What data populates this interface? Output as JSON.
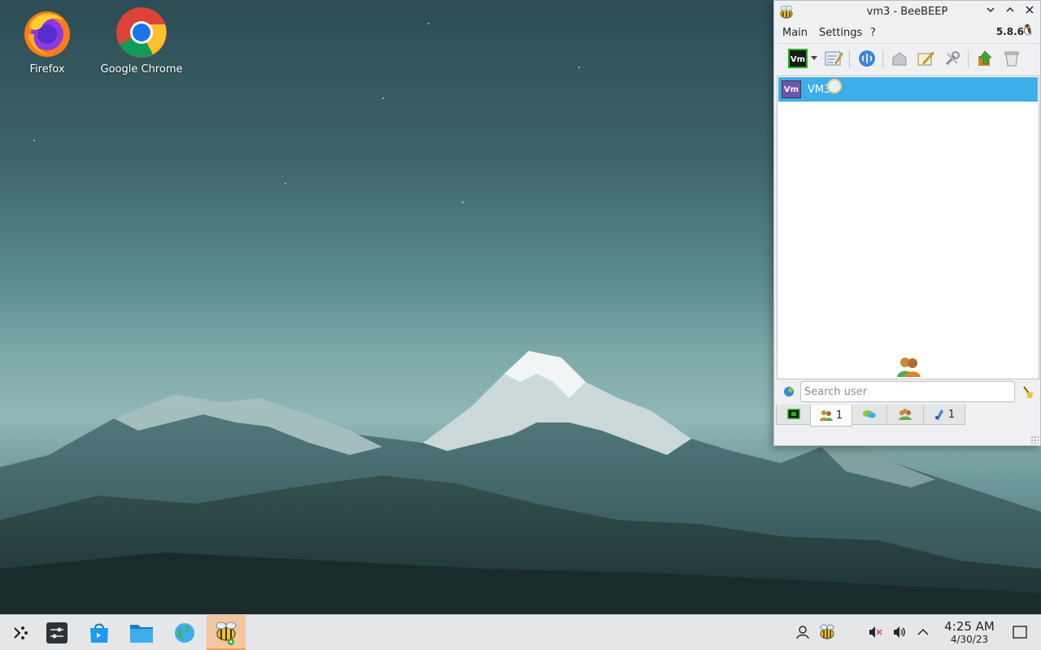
{
  "desktop": {
    "icons": [
      {
        "label": "Firefox",
        "icon": "firefox-icon"
      },
      {
        "label": "Google Chrome",
        "icon": "chrome-icon"
      }
    ]
  },
  "window": {
    "title": "vm3 - BeeBEEP",
    "menu": {
      "main": "Main",
      "settings": "Settings",
      "help": "?"
    },
    "version": "5.8.6",
    "toolbar": [
      "user-status-icon",
      "dropdown-arrow-icon",
      "profile-edit-icon",
      "network-icon",
      "home-icon",
      "pencil-note-icon",
      "tools-icon",
      "update-icon",
      "trash-icon"
    ],
    "users": [
      {
        "avatar": "Vm",
        "name": "VM3"
      }
    ],
    "search": {
      "placeholder": "Search user",
      "value": ""
    },
    "tabs": [
      {
        "icon": "screen-icon",
        "count": ""
      },
      {
        "icon": "users-icon",
        "count": "1"
      },
      {
        "icon": "chat-icon",
        "count": ""
      },
      {
        "icon": "group-icon",
        "count": ""
      },
      {
        "icon": "file-share-icon",
        "count": "1"
      }
    ]
  },
  "taskbar": {
    "apps": [
      "app-launcher-icon",
      "settings-icon",
      "discover-icon",
      "file-manager-icon",
      "browser-icon",
      "beebeep-icon"
    ],
    "tray": [
      "user-icon",
      "beebeep-tray-icon",
      "mute-icon",
      "volume-icon",
      "expand-tray-icon",
      "show-desktop-icon"
    ],
    "time": "4:25 AM",
    "date": "4/30/23"
  },
  "colors": {
    "selection": "#3daee9",
    "avatar": "#6e55b0",
    "taskbar_active": "#f3c6a0"
  }
}
